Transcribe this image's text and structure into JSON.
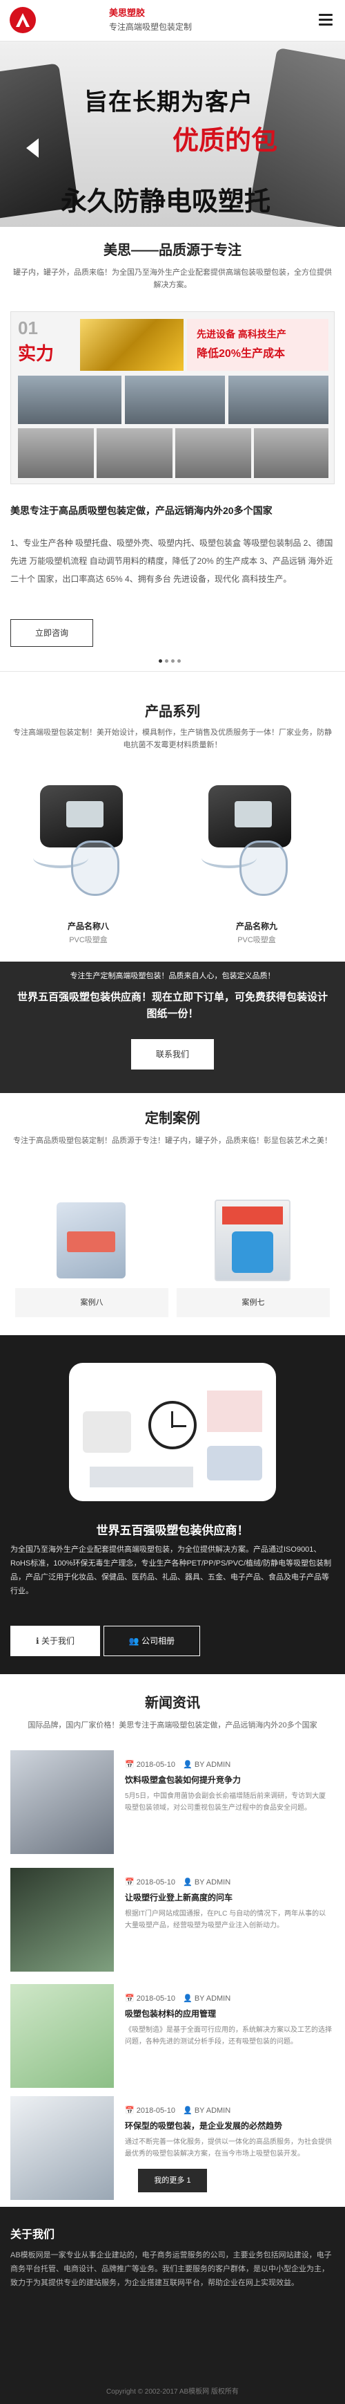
{
  "header": {
    "brand": "美思塑胶",
    "tagline": "专注高端吸塑包装定制"
  },
  "banner": {
    "line1": "旨在长期为客户",
    "line2": "优质的包",
    "line3": "永久防静电吸塑托"
  },
  "about": {
    "title": "美思——品质源于专注",
    "subtitle": "罐子内，罐子外，品质来临！为全国乃至海外生产企业配套提供高端包装吸塑包装，全方位提供解决方案。",
    "img": {
      "num": "01",
      "slogan": "实力",
      "r1": "先进设备 高科技生产",
      "r2": "降低20%生产成本"
    },
    "heading": "美思专注于高品质吸塑包装定做，产品远销海内外20多个国家",
    "para": "1、专业生产各种 吸塑托盘、吸塑外壳、吸塑内托、吸塑包装盒 等吸塑包装制品 2、德国 先进 万能吸塑机流程 自动调节用料的精度，降低了20% 的生产成本 3、产品远销 海外近二十个 国家，出口率高达 65% 4、拥有多台 先进设备，现代化 高科技生产。",
    "button": "立即咨询"
  },
  "products": {
    "title": "产品系列",
    "subtitle": "专注高端吸塑包装定制！美开始设计，模具制作，生产销售及优质服务于一体！厂家业务，防静电抗菌不发霉更材料质量新！",
    "items": [
      {
        "name": "产品名称八",
        "cat": "PVC吸塑盒"
      },
      {
        "name": "产品名称九",
        "cat": "PVC吸塑盒"
      }
    ]
  },
  "cta": {
    "t1": "专注生产定制高端吸塑包装！品质来自人心，包装定义品质！",
    "t2": "世界五百强吸塑包装供应商！现在立即下订单，可免费获得包装设计图纸一份！",
    "button": "联系我们"
  },
  "cases": {
    "title": "定制案例",
    "subtitle": "专注于高品质吸塑包装定制！品质源于专注！罐子内，罐子外，品质来临！彰显包装艺术之美！",
    "items": [
      {
        "name": "案例八"
      },
      {
        "name": "案例七"
      }
    ]
  },
  "supplier": {
    "heading": "世界五百强吸塑包装供应商！",
    "para": "为全国乃至海外生产企业配套提供高端吸塑包装，为全位提供解决方案。产品通过ISO9001、RoHS标准，100%环保无毒生产理念，专业生产各种PET/PP/PS/PVC/植绒/防静电等吸塑包装制品，产品广泛用于化妆品、保健品、医药品、礼品、器具、五金、电子产品、食品及电子产品等行业。",
    "btn_about": "关于我们",
    "btn_company": "公司相册"
  },
  "news": {
    "title": "新闻资讯",
    "subtitle": "国际品牌，国内厂家价格！美思专注于高端吸塑包装定做，产品远销海内外20多个国家",
    "items": [
      {
        "date": "2018-05-10",
        "author": "BY ADMIN",
        "title": "饮料吸塑盒包装如何提升竞争力",
        "desc": "5月5日，中国食用菌协会副会长俞福增随后前来调研，专访到大厦吸塑包装领域，对公司重视包装生产过程中的食品安全问题。"
      },
      {
        "date": "2018-05-10",
        "author": "BY ADMIN",
        "title": "让吸塑行业登上新高度的问车",
        "desc": "根据IT门户网站成国通报，在PLC 与自动的情况下，两年从事的以大量吸塑产品，经营吸塑为吸塑产业注入创新动力。"
      },
      {
        "date": "2018-05-10",
        "author": "BY ADMIN",
        "title": "吸塑包装材料的应用管理",
        "desc": "《吸塑制造》是基于全面可行应用的，系统解决方案以及工艺的选择问题，各种先进的测试分析手段，还有吸塑包装的问题。"
      },
      {
        "date": "2018-05-10",
        "author": "BY ADMIN",
        "title": "环保型的吸塑包装，是企业发展的必然趋势",
        "desc": "通过不断完善一体化服务，提供以一体化的高品质服务，为社会提供最优秀的吸塑包装解决方案，在当今市场上吸塑包装开发。"
      }
    ],
    "more": "我的更多 1"
  },
  "footer": {
    "title": "关于我们",
    "para": "AB模板网是一家专业从事企业建站的，电子商务运营服务的公司，主要业务包括网站建设，电子商务平台托管、电商设计、品牌推广等业务。我们主要服务的客户群体，是以中小型企业为主，致力于为其提供专业的建站服务，为企业搭建互联网平台，帮助企业在网上实现效益。",
    "copyright": "Copyright © 2002-2017 AB模板网 版权所有"
  }
}
